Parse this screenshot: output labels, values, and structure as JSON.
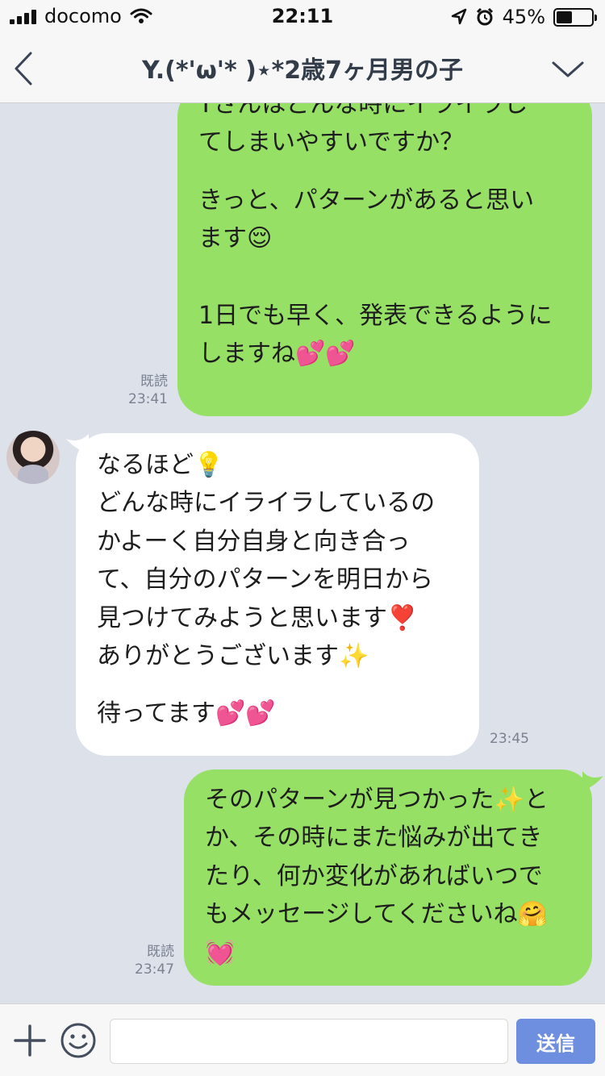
{
  "status_bar": {
    "carrier": "docomo",
    "time": "22:11",
    "battery_percent": "45%",
    "battery_level": 0.45
  },
  "header": {
    "title": "Y.(*'ω'* )⋆*2歳7ヶ月男の子",
    "back_icon": "chevron-left-icon",
    "menu_icon": "chevron-down-icon"
  },
  "messages": [
    {
      "side": "right",
      "lines": [
        "Yさんはどんな時にイライラし",
        "てしまいやすいですか？",
        "",
        "きっと、パターンがあると思い",
        "ます😌",
        "",
        "",
        "1日でも早く、発表できるように",
        "しますね💕💕"
      ],
      "read": "既読",
      "time": "23:41"
    },
    {
      "side": "left",
      "lines": [
        "なるほど💡",
        "どんな時にイライラしているの",
        "かよーく自分自身と向き合っ",
        "て、自分のパターンを明日から",
        "見つけてみようと思います❣️",
        "ありがとうございます✨",
        "",
        "待ってます💕💕"
      ],
      "time": "23:45"
    },
    {
      "side": "right",
      "lines": [
        "そのパターンが見つかった✨と",
        "か、その時にまた悩みが出てき",
        "たり、何か変化があればいつで",
        "もメッセージしてくださいね🤗",
        "💓"
      ],
      "read": "既読",
      "time": "23:47"
    }
  ],
  "input_bar": {
    "placeholder": "",
    "send_label": "送信",
    "plus_icon": "plus-icon",
    "emoji_icon": "smiley-icon"
  }
}
